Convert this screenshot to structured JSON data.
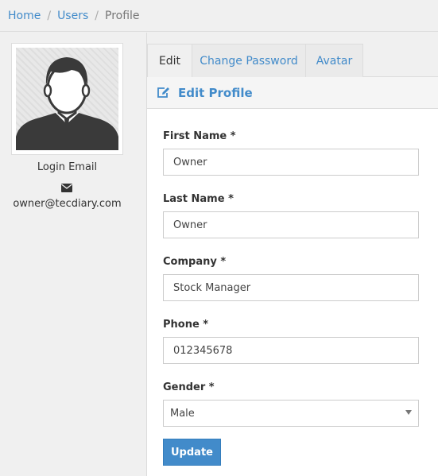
{
  "breadcrumb": {
    "items": [
      "Home",
      "Users"
    ],
    "current": "Profile",
    "separator": "/"
  },
  "profile": {
    "avatar_icon": "user-silhouette-icon",
    "login_email_label": "Login Email",
    "email_icon": "envelope-icon",
    "email": "owner@tecdiary.com"
  },
  "tabs": [
    {
      "label": "Edit",
      "active": true
    },
    {
      "label": "Change Password",
      "active": false
    },
    {
      "label": "Avatar",
      "active": false
    }
  ],
  "panel": {
    "icon": "edit-icon",
    "title": "Edit Profile"
  },
  "form": {
    "first_name": {
      "label": "First Name *",
      "value": "Owner"
    },
    "last_name": {
      "label": "Last Name *",
      "value": "Owner"
    },
    "company": {
      "label": "Company *",
      "value": "Stock Manager"
    },
    "phone": {
      "label": "Phone *",
      "value": "012345678"
    },
    "gender": {
      "label": "Gender *",
      "value": "Male"
    },
    "submit_label": "Update"
  },
  "colors": {
    "accent": "#428bca",
    "background": "#f0f0f0"
  }
}
